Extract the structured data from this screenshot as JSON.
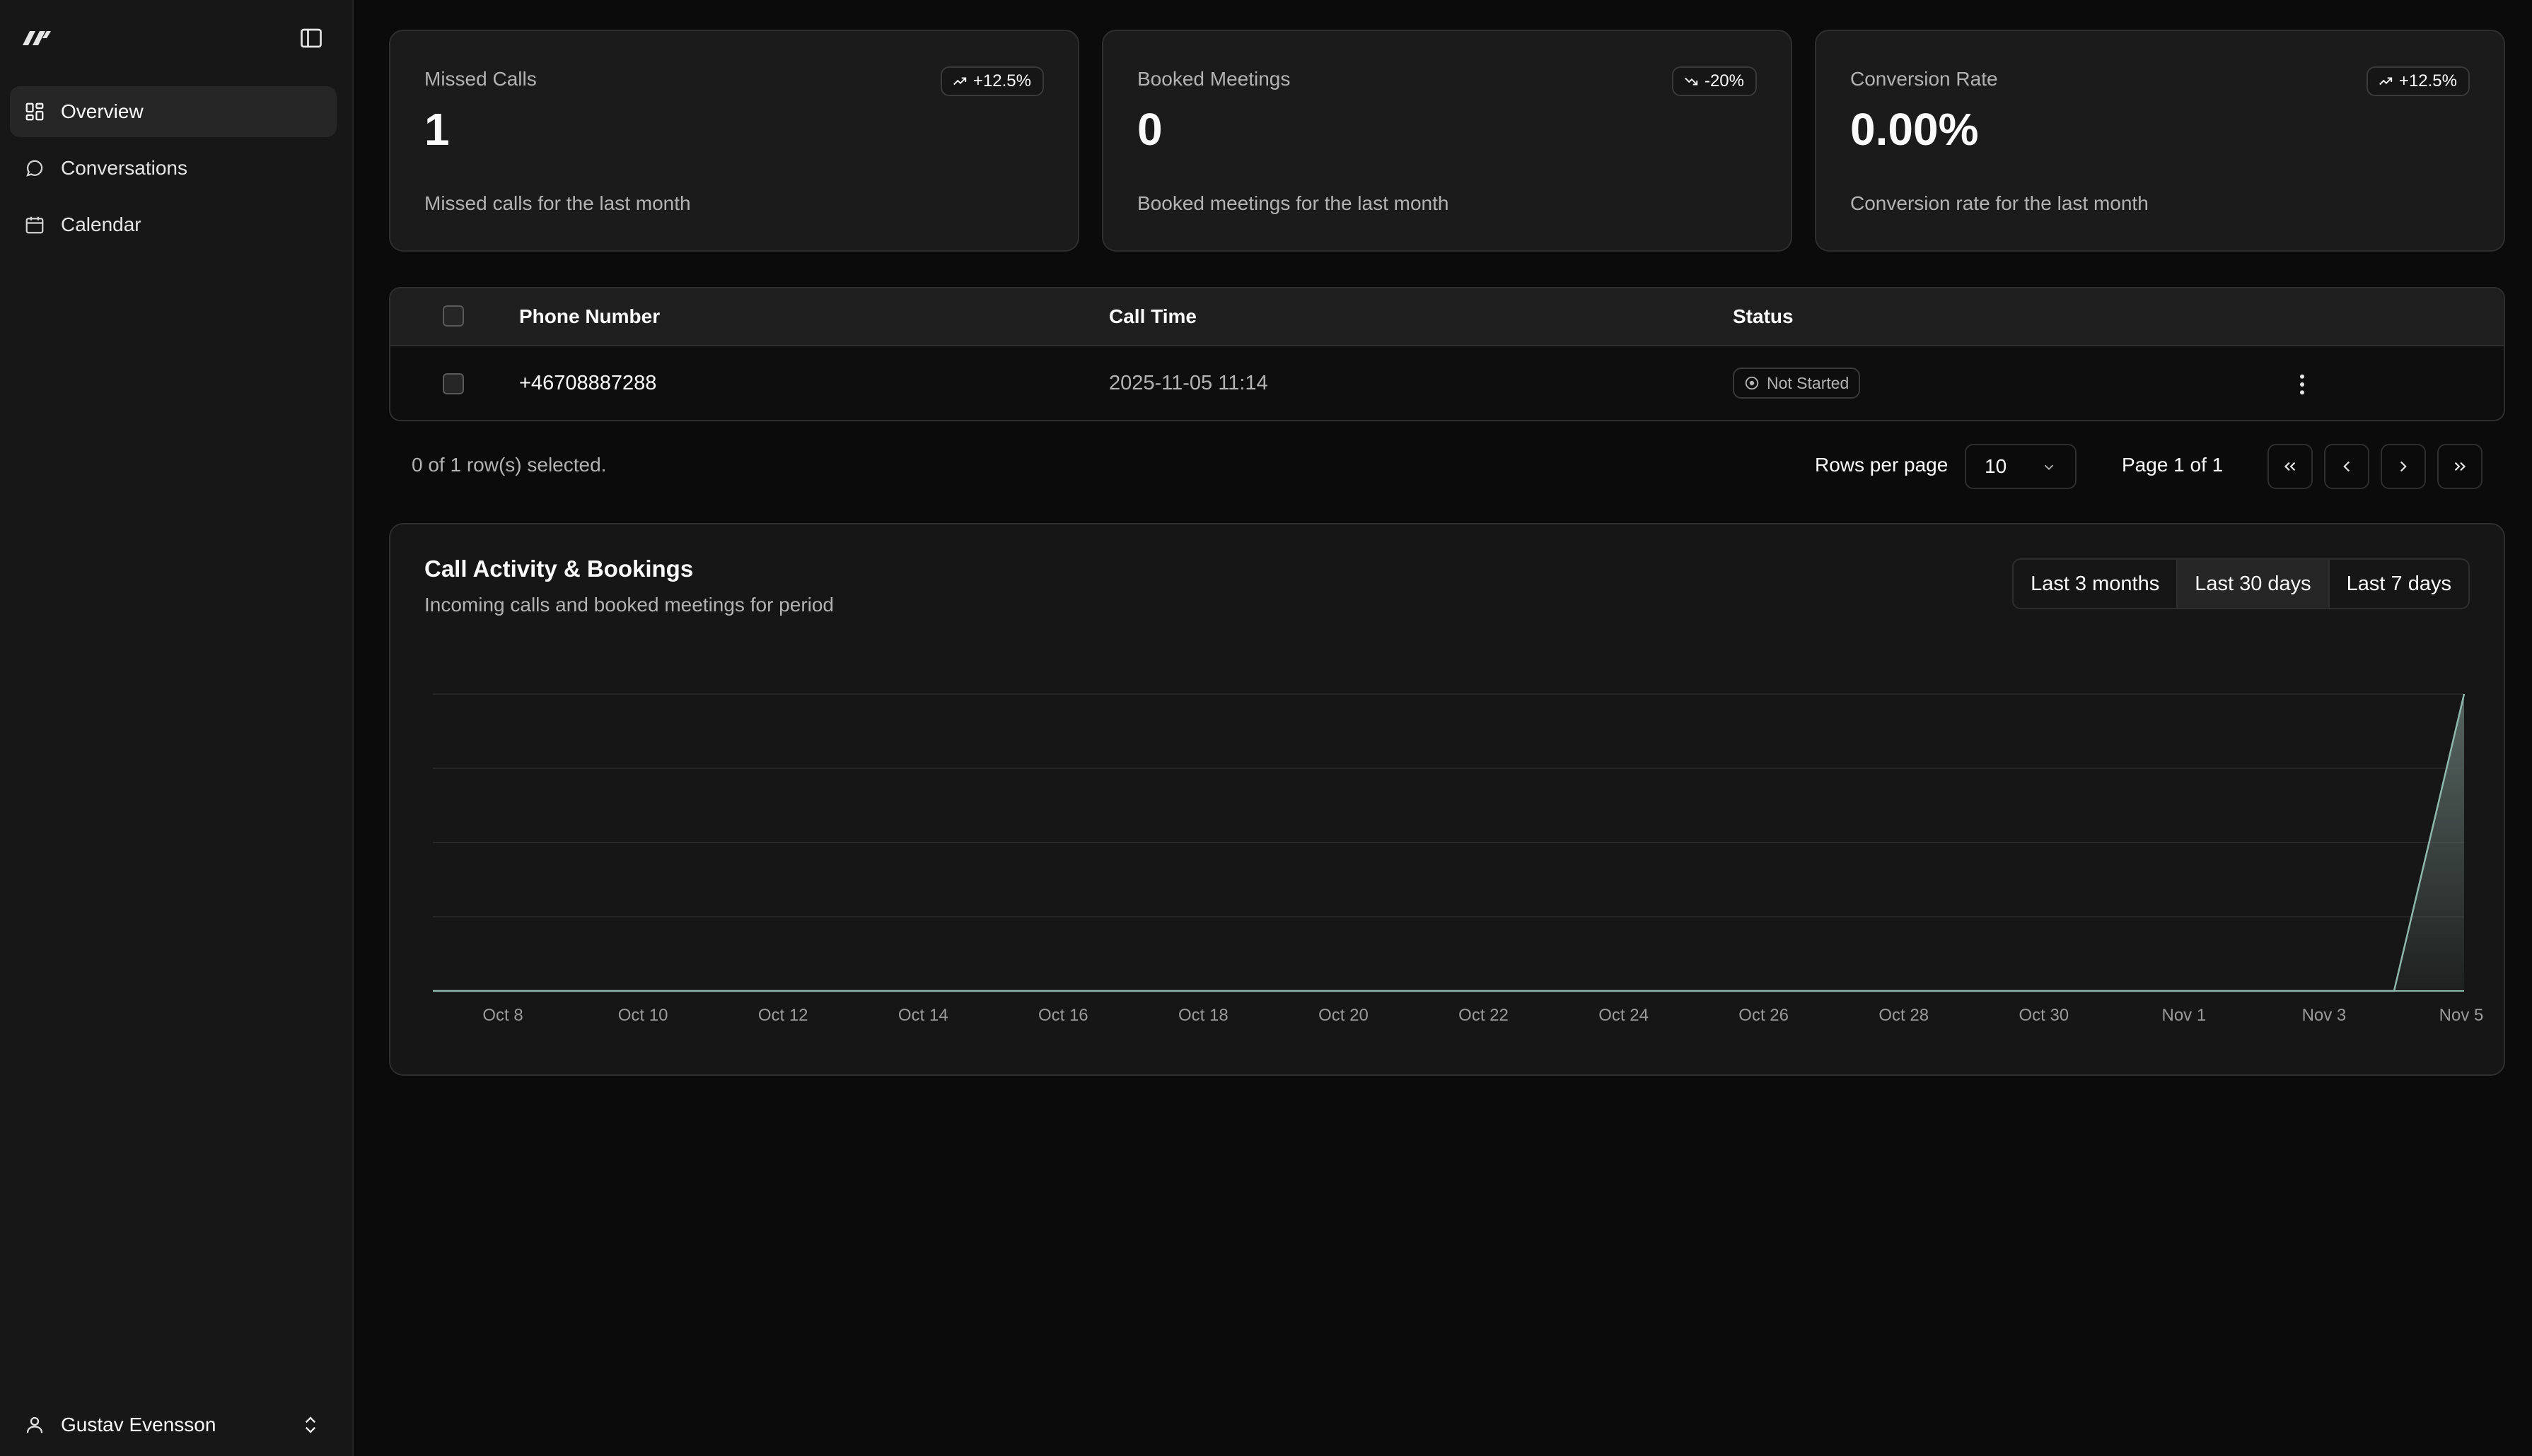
{
  "sidebar": {
    "logo": "brand-logo",
    "nav": [
      {
        "label": "Overview",
        "icon": "dashboard-grid-icon",
        "active": true
      },
      {
        "label": "Conversations",
        "icon": "message-circle-icon",
        "active": false
      },
      {
        "label": "Calendar",
        "icon": "calendar-icon",
        "active": false
      }
    ],
    "user": {
      "name": "Gustav Evensson",
      "icon": "user-icon"
    }
  },
  "stats": [
    {
      "title": "Missed Calls",
      "value": "1",
      "badge": "+12.5%",
      "trend": "up",
      "description": "Missed calls for the last month"
    },
    {
      "title": "Booked Meetings",
      "value": "0",
      "badge": "-20%",
      "trend": "down",
      "description": "Booked meetings for the last month"
    },
    {
      "title": "Conversion Rate",
      "value": "0.00%",
      "badge": "+12.5%",
      "trend": "up",
      "description": "Conversion rate for the last month"
    }
  ],
  "table": {
    "columns": [
      "Phone Number",
      "Call Time",
      "Status"
    ],
    "rows": [
      {
        "phone": "+46708887288",
        "time": "2025-11-05 11:14",
        "status": "Not Started"
      }
    ]
  },
  "pagination": {
    "selected_text": "0 of 1 row(s) selected.",
    "rows_per_page_label": "Rows per page",
    "rows_per_page": "10",
    "page_info": "Page 1 of 1"
  },
  "chart": {
    "title": "Call Activity & Bookings",
    "subtitle": "Incoming calls and booked meetings for period",
    "ranges": [
      "Last 3 months",
      "Last 30 days",
      "Last 7 days"
    ],
    "active_range": "Last 30 days"
  },
  "chart_data": {
    "type": "area",
    "x": [
      "Oct 7",
      "Oct 8",
      "Oct 9",
      "Oct 10",
      "Oct 11",
      "Oct 12",
      "Oct 13",
      "Oct 14",
      "Oct 15",
      "Oct 16",
      "Oct 17",
      "Oct 18",
      "Oct 19",
      "Oct 20",
      "Oct 21",
      "Oct 22",
      "Oct 23",
      "Oct 24",
      "Oct 25",
      "Oct 26",
      "Oct 27",
      "Oct 28",
      "Oct 29",
      "Oct 30",
      "Oct 31",
      "Nov 1",
      "Nov 2",
      "Nov 3",
      "Nov 4",
      "Nov 5"
    ],
    "tick_labels": [
      "Oct 8",
      "Oct 10",
      "Oct 12",
      "Oct 14",
      "Oct 16",
      "Oct 18",
      "Oct 20",
      "Oct 22",
      "Oct 24",
      "Oct 26",
      "Oct 28",
      "Oct 30",
      "Nov 1",
      "Nov 3",
      "Nov 5"
    ],
    "series": [
      {
        "values": [
          0,
          0,
          0,
          0,
          0,
          0,
          0,
          0,
          0,
          0,
          0,
          0,
          0,
          0,
          0,
          0,
          0,
          0,
          0,
          0,
          0,
          0,
          0,
          0,
          0,
          0,
          0,
          0,
          0,
          1
        ]
      }
    ],
    "ylim": [
      0,
      1
    ],
    "grid": true,
    "colors": {
      "line": "#8fb8ad",
      "fill_top": "#5e6f6a",
      "grid": "#262626",
      "axis": "#8fb8ad"
    }
  },
  "colors": {
    "background": "#0b0b0b",
    "sidebar": "#171717",
    "card": "#1b1b1b",
    "border": "#2e2e2e",
    "muted_text": "#b3b3b3"
  }
}
